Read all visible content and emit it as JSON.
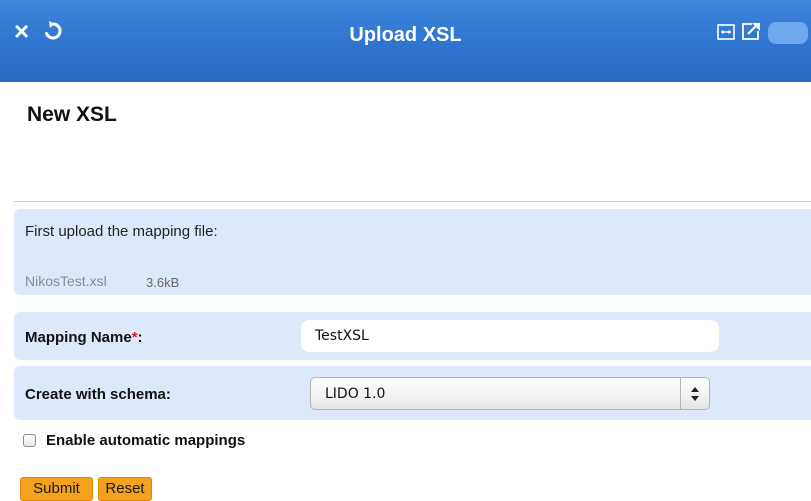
{
  "window": {
    "title": "Upload XSL",
    "close_symbol": "×",
    "accent_color": "#2f74cf"
  },
  "icons": [
    "close-icon",
    "refresh-icon",
    "expand-icon",
    "share-icon"
  ],
  "page": {
    "heading": "New XSL"
  },
  "upload": {
    "label": "First upload the mapping file:",
    "file_name": "NikosTest.xsl",
    "file_size": "3.6kB"
  },
  "mapping_name": {
    "label": "Mapping Name",
    "required_mark": "*",
    "colon": ":",
    "value": "TestXSL"
  },
  "schema": {
    "label": "Create with schema:",
    "selected": "LIDO 1.0"
  },
  "auto_mappings": {
    "label": "Enable automatic mappings",
    "checked": false
  },
  "buttons": {
    "submit": "Submit",
    "reset": "Reset",
    "button_color": "#f4a21b"
  }
}
